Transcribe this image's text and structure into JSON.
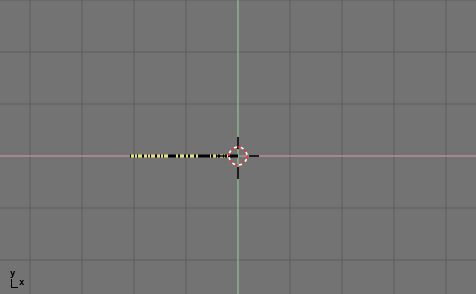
{
  "viewport": {
    "background_color": "#737373",
    "grid_line_color": "#5d5d5d",
    "x_axis_color": "#d99aa0",
    "y_axis_color": "#8fd39a",
    "selected_edge_color": "#e8e27a",
    "unselected_edge_color": "#000000",
    "cursor_ring_colors": [
      "#ff3030",
      "#ffffff"
    ]
  },
  "axis_indicator": {
    "y_label": "y",
    "x_label": "x"
  },
  "icons": {
    "cursor": "3d-cursor-icon",
    "axis": "axis-orientation-icon"
  }
}
